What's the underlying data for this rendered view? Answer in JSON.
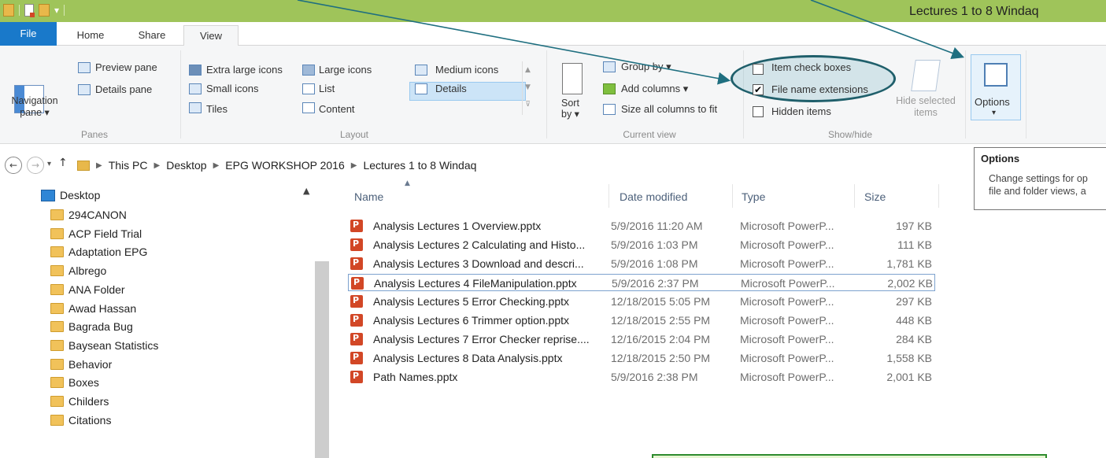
{
  "window": {
    "title": "Lectures 1 to 8 Windaq"
  },
  "tabs": [
    "File",
    "Home",
    "Share",
    "View"
  ],
  "ribbon": {
    "panes": {
      "navigation_pane": "Navigation\npane ▾",
      "preview_pane": "Preview pane",
      "details_pane": "Details pane",
      "label": "Panes"
    },
    "layout": {
      "extra_large_icons": "Extra large icons",
      "large_icons": "Large icons",
      "medium_icons": "Medium icons",
      "small_icons": "Small icons",
      "list": "List",
      "details": "Details",
      "tiles": "Tiles",
      "content": "Content",
      "label": "Layout"
    },
    "current_view": {
      "sort_by": "Sort\nby ▾",
      "group_by": "Group by ▾",
      "add_columns": "Add columns ▾",
      "size_all_columns": "Size all columns to fit",
      "label": "Current view"
    },
    "show_hide": {
      "item_check_boxes": "Item check boxes",
      "file_name_extensions": "File name extensions",
      "hidden_items": "Hidden items",
      "hide_selected_items": "Hide selected\nitems",
      "label": "Show/hide",
      "file_name_extensions_checked": true
    },
    "options": {
      "label": "Options",
      "caret": "▾"
    }
  },
  "address": {
    "crumbs": [
      "This PC",
      "Desktop",
      "EPG WORKSHOP 2016",
      "Lectures 1 to 8 Windaq"
    ]
  },
  "tooltip": {
    "title": "Options",
    "line1": "Change settings for op",
    "line2": "file and folder views, a"
  },
  "navtree": {
    "root": "Desktop",
    "items": [
      "294CANON",
      "ACP Field Trial",
      "Adaptation EPG",
      "Albrego",
      "ANA Folder",
      "Awad Hassan",
      "Bagrada Bug",
      "Baysean Statistics",
      "Behavior",
      "Boxes",
      "Childers",
      "Citations"
    ]
  },
  "columns": {
    "name": "Name",
    "date": "Date modified",
    "type": "Type",
    "size": "Size"
  },
  "files": [
    {
      "name": "Analysis Lectures 1 Overview.pptx",
      "date": "5/9/2016 11:20 AM",
      "type": "Microsoft PowerP...",
      "size": "197 KB"
    },
    {
      "name": "Analysis Lectures 2 Calculating and Histo...",
      "date": "5/9/2016 1:03 PM",
      "type": "Microsoft PowerP...",
      "size": "111 KB"
    },
    {
      "name": "Analysis Lectures 3 Download and descri...",
      "date": "5/9/2016 1:08 PM",
      "type": "Microsoft PowerP...",
      "size": "1,781 KB"
    },
    {
      "name": "Analysis Lectures 4 FileManipulation.pptx",
      "date": "5/9/2016 2:37 PM",
      "type": "Microsoft PowerP...",
      "size": "2,002 KB"
    },
    {
      "name": "Analysis Lectures 5 Error Checking.pptx",
      "date": "12/18/2015 5:05 PM",
      "type": "Microsoft PowerP...",
      "size": "297 KB"
    },
    {
      "name": "Analysis Lectures 6 Trimmer option.pptx",
      "date": "12/18/2015 2:55 PM",
      "type": "Microsoft PowerP...",
      "size": "448 KB"
    },
    {
      "name": "Analysis Lectures 7 Error Checker reprise....",
      "date": "12/16/2015 2:04 PM",
      "type": "Microsoft PowerP...",
      "size": "284 KB"
    },
    {
      "name": "Analysis Lectures 8 Data Analysis.pptx",
      "date": "12/18/2015 2:50 PM",
      "type": "Microsoft PowerP...",
      "size": "1,558 KB"
    },
    {
      "name": "Path Names.pptx",
      "date": "5/9/2016 2:38 PM",
      "type": "Microsoft PowerP...",
      "size": "2,001 KB"
    }
  ],
  "selected_file_index": 3,
  "colors": {
    "titlebar": "#9fc45a",
    "file_tab": "#1979ca",
    "accent_arrow": "#1f6f80"
  }
}
